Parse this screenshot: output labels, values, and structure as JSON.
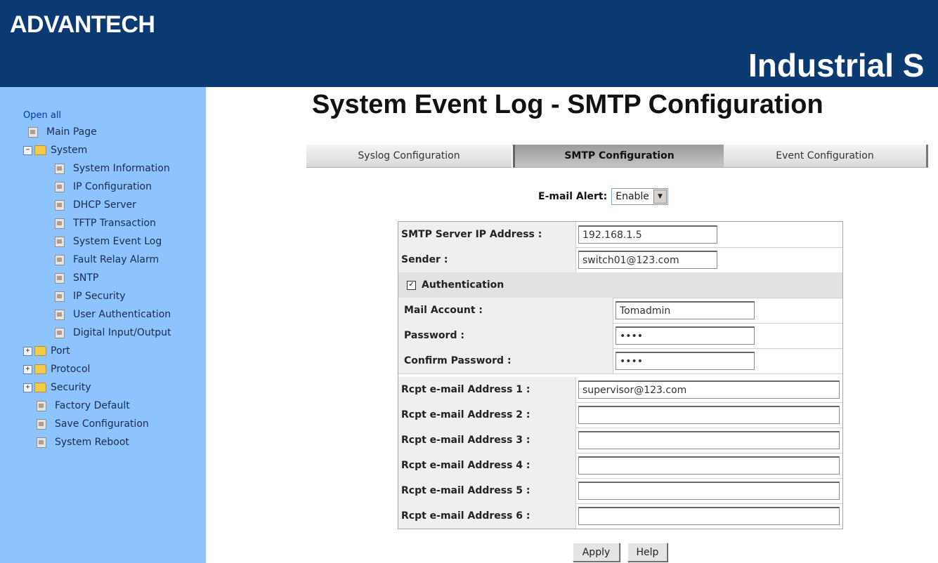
{
  "header": {
    "logo": "ADVANTECH",
    "product": "Industrial S"
  },
  "sidebar": {
    "open_all": "Open all",
    "items": [
      {
        "label": "Main Page",
        "icon": "doc-icon",
        "toggle": ""
      },
      {
        "label": "System",
        "icon": "folder-icon",
        "toggle": "−"
      },
      {
        "label": "System Information",
        "icon": "doc-icon",
        "toggle": ""
      },
      {
        "label": "IP Configuration",
        "icon": "doc-icon",
        "toggle": ""
      },
      {
        "label": "DHCP Server",
        "icon": "doc-icon",
        "toggle": ""
      },
      {
        "label": "TFTP Transaction",
        "icon": "doc-icon",
        "toggle": ""
      },
      {
        "label": "System Event Log",
        "icon": "doc-icon",
        "toggle": ""
      },
      {
        "label": "Fault Relay Alarm",
        "icon": "doc-icon",
        "toggle": ""
      },
      {
        "label": "SNTP",
        "icon": "doc-icon",
        "toggle": ""
      },
      {
        "label": "IP Security",
        "icon": "doc-icon",
        "toggle": ""
      },
      {
        "label": "User Authentication",
        "icon": "doc-icon",
        "toggle": ""
      },
      {
        "label": "Digital Input/Output",
        "icon": "doc-icon",
        "toggle": ""
      },
      {
        "label": "Port",
        "icon": "folder-icon",
        "toggle": "+"
      },
      {
        "label": "Protocol",
        "icon": "folder-icon",
        "toggle": "+"
      },
      {
        "label": "Security",
        "icon": "folder-icon",
        "toggle": "+"
      },
      {
        "label": "Factory Default",
        "icon": "doc-icon",
        "toggle": ""
      },
      {
        "label": "Save Configuration",
        "icon": "doc-icon",
        "toggle": ""
      },
      {
        "label": "System Reboot",
        "icon": "doc-icon",
        "toggle": ""
      }
    ]
  },
  "page": {
    "title": "System Event Log - SMTP Configuration"
  },
  "tabs": [
    {
      "label": "Syslog Configuration",
      "active": false
    },
    {
      "label": "SMTP Configuration",
      "active": true
    },
    {
      "label": "Event Configuration",
      "active": false
    }
  ],
  "email_alert": {
    "label": "E-mail Alert:",
    "value": "Enable"
  },
  "form": {
    "smtp_server": {
      "label": "SMTP Server IP Address :",
      "value": "192.168.1.5"
    },
    "sender": {
      "label": "Sender :",
      "value": "switch01@123.com"
    },
    "authentication": {
      "label": "Authentication",
      "checked": true,
      "check_mark": "✓"
    },
    "mail_account": {
      "label": "Mail Account :",
      "value": "Tomadmin"
    },
    "password": {
      "label": "Password :",
      "value": "1234"
    },
    "confirm_password": {
      "label": "Confirm Password :",
      "value": "1234"
    },
    "rcpt": [
      {
        "label": "Rcpt e-mail Address 1 :",
        "value": "supervisor@123.com"
      },
      {
        "label": "Rcpt e-mail Address 2 :",
        "value": ""
      },
      {
        "label": "Rcpt e-mail Address 3 :",
        "value": ""
      },
      {
        "label": "Rcpt e-mail Address 4 :",
        "value": ""
      },
      {
        "label": "Rcpt e-mail Address 5 :",
        "value": ""
      },
      {
        "label": "Rcpt e-mail Address 6 :",
        "value": ""
      }
    ]
  },
  "buttons": {
    "apply": "Apply",
    "help": "Help"
  },
  "colors": {
    "header_bg": "#0b3a72",
    "sidebar_bg": "#8dc3ff",
    "link": "#0033aa"
  }
}
